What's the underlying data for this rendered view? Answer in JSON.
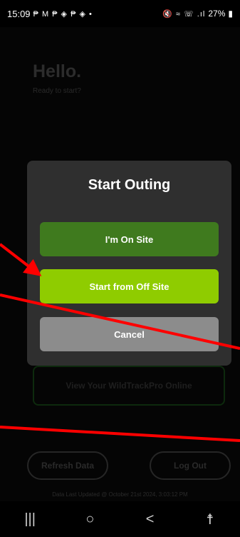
{
  "status_bar": {
    "time": "15:09",
    "notification_icons": "₱ M ₱ ◈ ₱ ◈ •",
    "system_icons": "🔇 ≈ ☏ .ıl",
    "battery": "27%"
  },
  "home": {
    "greeting": "Hello.",
    "subtitle": "Ready to start?",
    "view_online_label": "View Your WildTrackPro Online",
    "refresh_label": "Refresh Data",
    "logout_label": "Log Out",
    "last_updated": "Data Last Updated @ October 21st 2024, 3:03:12 PM"
  },
  "dialog": {
    "title": "Start Outing",
    "on_site_label": "I'm On Site",
    "off_site_label": "Start from Off Site",
    "cancel_label": "Cancel"
  },
  "nav_bar": {
    "recents": "|||",
    "home": "○",
    "back": "<",
    "accessibility": "☨"
  },
  "colors": {
    "on_site": "#3f7a1e",
    "off_site": "#8fcc00",
    "cancel": "#8c8c8c",
    "dialog_bg": "#2f2f2f",
    "annotation_red": "#ff0000"
  }
}
